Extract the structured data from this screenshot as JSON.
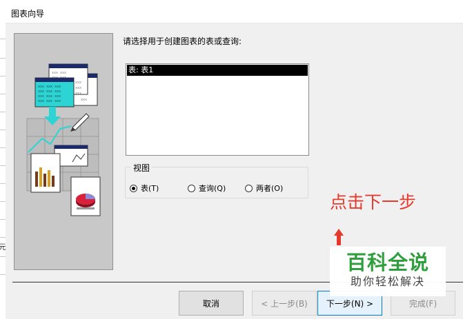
{
  "window": {
    "title": "图表向导"
  },
  "background": {
    "side_glyph": "元"
  },
  "prompt": "请选择用于创建图表的表或查询:",
  "list": {
    "items": [
      "表: 表1"
    ]
  },
  "view_group": {
    "legend": "视图",
    "options": [
      {
        "label": "表(T)",
        "selected": true
      },
      {
        "label": "查询(Q)",
        "selected": false
      },
      {
        "label": "两者(O)",
        "selected": false
      }
    ]
  },
  "buttons": {
    "cancel": "取消",
    "back": "< 上一步(B)",
    "next": "下一步(N) >",
    "finish": "完成(F)"
  },
  "annotation": {
    "text": "点击下一步",
    "color": "#e43a2e"
  },
  "watermark": {
    "title": "百科全说",
    "subtitle": "助你轻松解决",
    "color": "#2f9e3c"
  },
  "colors": {
    "accent": "#0078d7",
    "dialog_bg": "#f0f0f0",
    "selection": "#000000"
  }
}
